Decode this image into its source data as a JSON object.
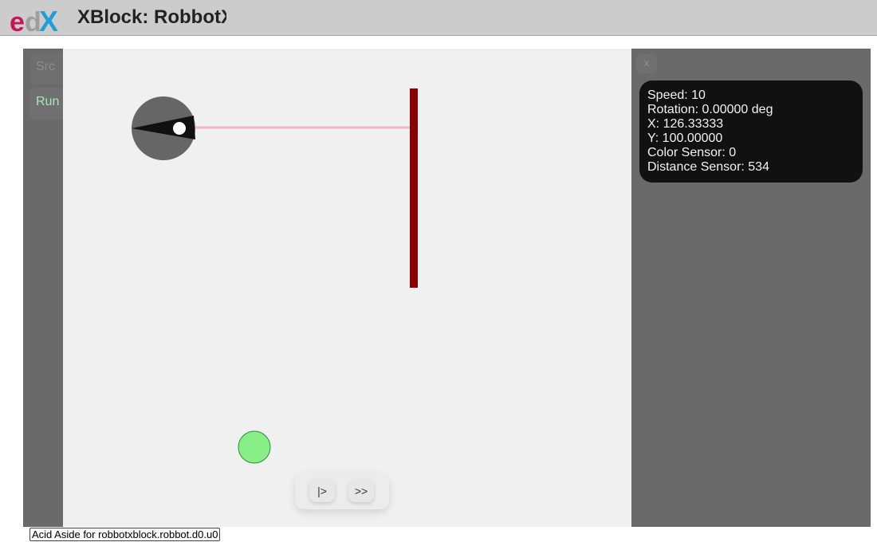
{
  "header": {
    "title": "XBlock: RobbotXBlock",
    "logo_icon": "edx-logo"
  },
  "sidebar": {
    "tabs": [
      {
        "label": "Src"
      },
      {
        "label": "Run"
      }
    ]
  },
  "arena": {
    "robot_icon": "robot-icon",
    "wall_color": "#8b0000",
    "target_color": "#88ee88",
    "sensor_ray_color": "#f4b6c2"
  },
  "controls": {
    "step_label": "|>",
    "fast_forward_label": ">>"
  },
  "status_panel": {
    "close_label": "x",
    "speed": "Speed: 10",
    "rotation": "Rotation: 0.00000 deg",
    "x": "X: 126.33333",
    "y": "Y: 100.00000",
    "color_sensor": "Color Sensor: 0",
    "distance_sensor": "Distance Sensor: 534"
  },
  "footer": {
    "aside_label": "Acid Aside for robbotxblock.robbot.d0.u0"
  }
}
